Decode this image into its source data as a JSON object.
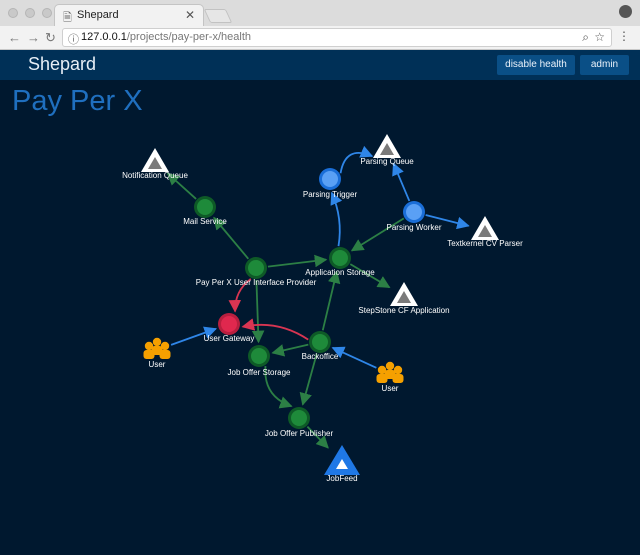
{
  "browser": {
    "tab_title": "Shepard",
    "url_host": "127.0.0.1",
    "url_path": "/projects/pay-per-x/health"
  },
  "app": {
    "brand": "Shepard",
    "disable_health_label": "disable health",
    "admin_label": "admin",
    "page_title": "Pay Per X"
  },
  "colors": {
    "background": "#00182f",
    "service_green": "#1e8a3a",
    "queue_blue": "#5aa0f5",
    "failing_red": "#e0284e",
    "user_orange": "#f5a000",
    "edge_green": "#2c7f45",
    "edge_blue": "#2f86e8",
    "edge_red": "#d83552"
  },
  "graph": {
    "nodes": [
      {
        "id": "notification-queue",
        "label": "Notification Queue",
        "kind": "external-triangle"
      },
      {
        "id": "mail-service",
        "label": "Mail Service",
        "kind": "service"
      },
      {
        "id": "parsing-queue",
        "label": "Parsing Queue",
        "kind": "external-triangle"
      },
      {
        "id": "parsing-trigger",
        "label": "Parsing Trigger",
        "kind": "queue"
      },
      {
        "id": "parsing-worker",
        "label": "Parsing Worker",
        "kind": "queue"
      },
      {
        "id": "textkernel-cv-parser",
        "label": "Textkernel CV Parser",
        "kind": "external-triangle"
      },
      {
        "id": "application-storage",
        "label": "Application Storage",
        "kind": "service"
      },
      {
        "id": "ui-provider",
        "label": "Pay Per X User Interface Provider",
        "kind": "service"
      },
      {
        "id": "stepstone-cf",
        "label": "StepStone CF Application",
        "kind": "external-triangle"
      },
      {
        "id": "user-gateway",
        "label": "User Gateway",
        "kind": "failing"
      },
      {
        "id": "backoffice",
        "label": "Backoffice",
        "kind": "service"
      },
      {
        "id": "job-offer-storage",
        "label": "Job Offer Storage",
        "kind": "service"
      },
      {
        "id": "user-left",
        "label": "User",
        "kind": "user"
      },
      {
        "id": "user-right",
        "label": "User",
        "kind": "user"
      },
      {
        "id": "job-offer-publisher",
        "label": "Job Offer Publisher",
        "kind": "service"
      },
      {
        "id": "jobfeed",
        "label": "JobFeed",
        "kind": "external-blue-triangle"
      }
    ],
    "edges": [
      {
        "from": "mail-service",
        "to": "notification-queue",
        "color": "green"
      },
      {
        "from": "ui-provider",
        "to": "mail-service",
        "color": "green"
      },
      {
        "from": "parsing-trigger",
        "to": "parsing-queue",
        "color": "blue"
      },
      {
        "from": "parsing-worker",
        "to": "parsing-queue",
        "color": "blue"
      },
      {
        "from": "parsing-worker",
        "to": "textkernel-cv-parser",
        "color": "blue"
      },
      {
        "from": "parsing-worker",
        "to": "application-storage",
        "color": "green"
      },
      {
        "from": "application-storage",
        "to": "parsing-trigger",
        "color": "blue"
      },
      {
        "from": "ui-provider",
        "to": "application-storage",
        "color": "green"
      },
      {
        "from": "application-storage",
        "to": "stepstone-cf",
        "color": "green"
      },
      {
        "from": "ui-provider",
        "to": "user-gateway",
        "color": "red"
      },
      {
        "from": "ui-provider",
        "to": "job-offer-storage",
        "color": "green"
      },
      {
        "from": "backoffice",
        "to": "user-gateway",
        "color": "red"
      },
      {
        "from": "backoffice",
        "to": "application-storage",
        "color": "green"
      },
      {
        "from": "backoffice",
        "to": "job-offer-storage",
        "color": "green"
      },
      {
        "from": "backoffice",
        "to": "job-offer-publisher",
        "color": "green"
      },
      {
        "from": "user-left",
        "to": "user-gateway",
        "color": "blue"
      },
      {
        "from": "user-right",
        "to": "backoffice",
        "color": "blue"
      },
      {
        "from": "job-offer-storage",
        "to": "job-offer-publisher",
        "color": "green"
      },
      {
        "from": "job-offer-publisher",
        "to": "jobfeed",
        "color": "green"
      }
    ]
  }
}
